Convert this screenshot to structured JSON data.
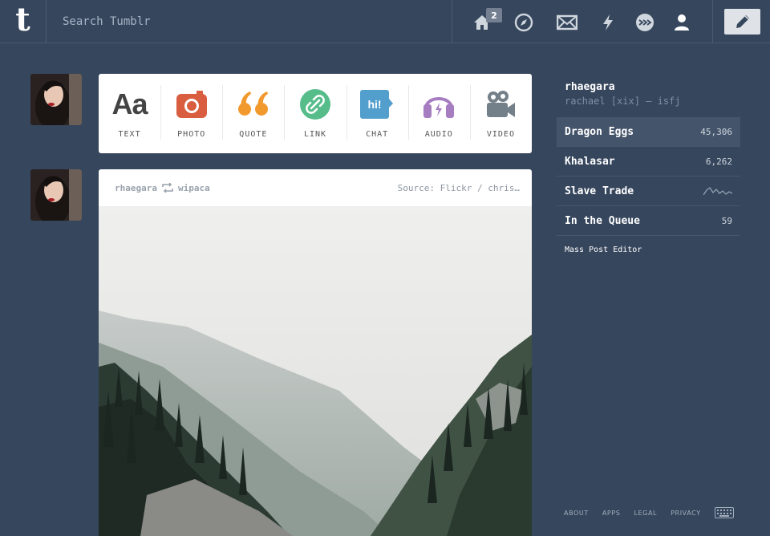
{
  "header": {
    "logo": "t",
    "search_placeholder": "Search Tumblr",
    "nav": [
      {
        "name": "home-icon",
        "badge": "2"
      },
      {
        "name": "explore-icon"
      },
      {
        "name": "inbox-icon"
      },
      {
        "name": "activity-icon"
      },
      {
        "name": "hub-icon"
      },
      {
        "name": "account-icon"
      }
    ],
    "compose_icon": "pencil-icon"
  },
  "post_types": [
    {
      "label": "TEXT",
      "icon": "text-icon",
      "color": "#444444"
    },
    {
      "label": "PHOTO",
      "icon": "camera-icon",
      "color": "#d95e40"
    },
    {
      "label": "QUOTE",
      "icon": "quote-icon",
      "color": "#f2992e"
    },
    {
      "label": "LINK",
      "icon": "link-icon",
      "color": "#56bc8a"
    },
    {
      "label": "CHAT",
      "icon": "chat-icon",
      "color": "#529ecc"
    },
    {
      "label": "AUDIO",
      "icon": "headphones-icon",
      "color": "#a77dc2"
    },
    {
      "label": "VIDEO",
      "icon": "video-camera-icon",
      "color": "#748089"
    }
  ],
  "text_icon_glyph": "Aa",
  "chat_icon_glyph": "hi!",
  "post": {
    "user": "rhaegara",
    "reblogged_from": "wipaca",
    "source": "Source: Flickr / chris…"
  },
  "sidebar": {
    "blog_name": "rhaegara",
    "blog_desc": "rachael [xix] — isfj",
    "rows": [
      {
        "label": "Dragon Eggs",
        "count": "45,306",
        "active": true
      },
      {
        "label": "Khalasar",
        "count": "6,262"
      },
      {
        "label": "Slave Trade",
        "count": ""
      },
      {
        "label": "In the Queue",
        "count": "59"
      }
    ],
    "mass_post_editor": "Mass Post Editor"
  },
  "footer": [
    "ABOUT",
    "APPS",
    "LEGAL",
    "PRIVACY"
  ],
  "colors": {
    "background": "#36465d",
    "accent": "#529ecc"
  }
}
